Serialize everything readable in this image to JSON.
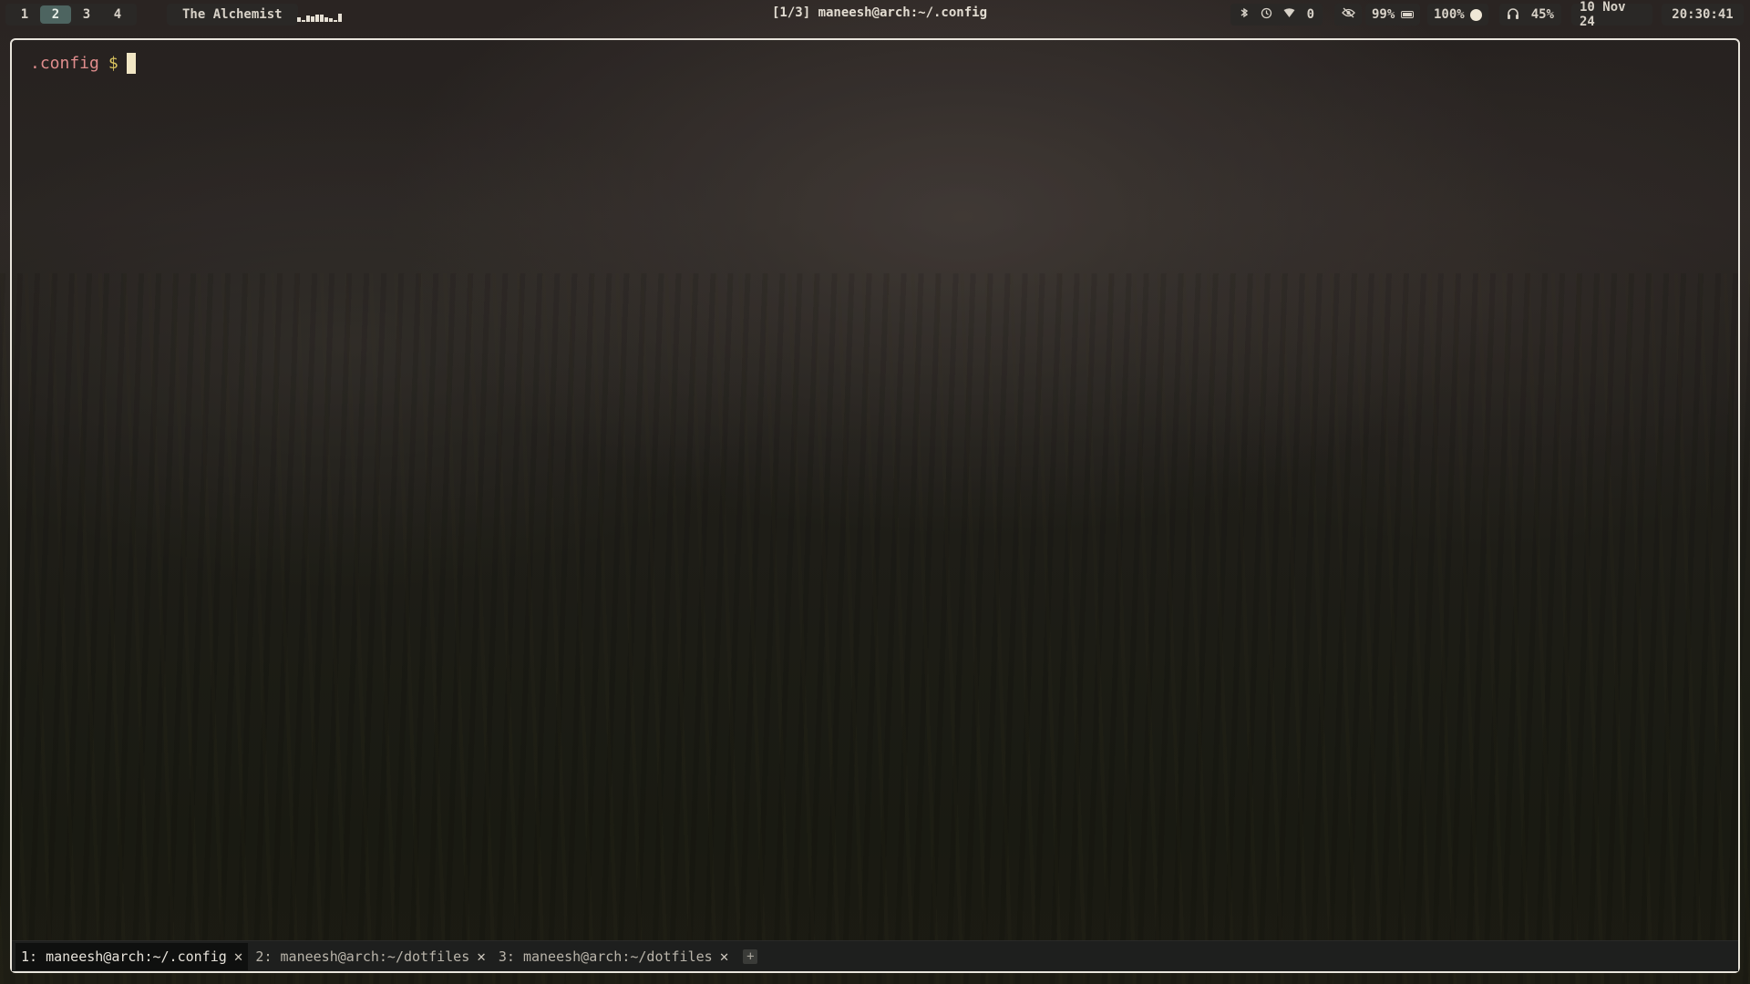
{
  "workspaces": [
    "1",
    "2",
    "3",
    "4"
  ],
  "active_workspace": "2",
  "now_playing": "The Alchemist",
  "visualizer_levels": [
    0.45,
    0.2,
    0.55,
    0.5,
    0.65,
    0.65,
    0.45,
    0.3,
    0.2,
    0.75
  ],
  "window_title": "[1/3] maneesh@arch:~/.config",
  "tray": {
    "icons": [
      "bluetooth-icon",
      "clock-icon",
      "wifi-icon"
    ],
    "notifications": "0"
  },
  "status": {
    "battery": "99%",
    "brightness": "100%",
    "volume": "45%",
    "date": "10 Nov 24",
    "time": "20:30:41"
  },
  "terminal": {
    "prompt_dir": ".config",
    "prompt_symbol": "$"
  },
  "tabs": [
    {
      "label": "1: maneesh@arch:~/.config",
      "active": true
    },
    {
      "label": "2: maneesh@arch:~/dotfiles",
      "active": false
    },
    {
      "label": "3: maneesh@arch:~/dotfiles",
      "active": false
    }
  ],
  "colors": {
    "prompt_dir": "#e08d8d",
    "prompt_symbol": "#d8c25e",
    "active_workspace": "#4d6460"
  }
}
